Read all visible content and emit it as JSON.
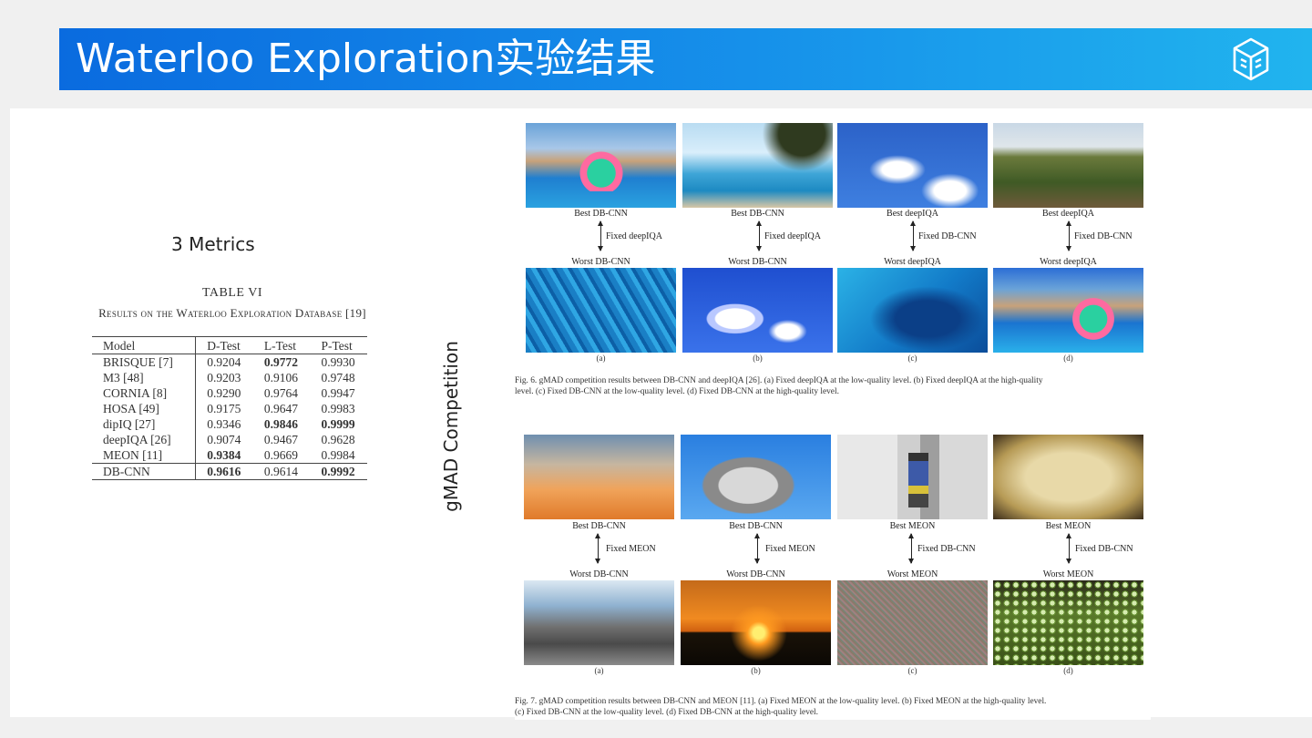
{
  "header": {
    "title": "Waterloo Exploration实验结果",
    "logo_icon": "cube-logo-icon",
    "gradient_colors": [
      "#0a6bdf",
      "#21b4ee"
    ]
  },
  "left": {
    "metrics_label": "3  Metrics",
    "table_number": "TABLE VI",
    "table_title": "Results on the Waterloo Exploration Database [19]",
    "columns": [
      "Model",
      "D-Test",
      "L-Test",
      "P-Test"
    ],
    "rows": [
      [
        "BRISQUE [7]",
        "0.9204",
        "0.9772",
        "0.9930"
      ],
      [
        "M3 [48]",
        "0.9203",
        "0.9106",
        "0.9748"
      ],
      [
        "CORNIA [8]",
        "0.9290",
        "0.9764",
        "0.9947"
      ],
      [
        "HOSA [49]",
        "0.9175",
        "0.9647",
        "0.9983"
      ],
      [
        "dipIQ [27]",
        "0.9346",
        "0.9846",
        "0.9999"
      ],
      [
        "deepIQA [26]",
        "0.9074",
        "0.9467",
        "0.9628"
      ],
      [
        "MEON [11]",
        "0.9384",
        "0.9669",
        "0.9984"
      ],
      [
        "DB-CNN",
        "0.9616",
        "0.9614",
        "0.9992"
      ]
    ]
  },
  "side_label": "gMAD Competition",
  "fig6": {
    "best": [
      "Best DB-CNN",
      "Best DB-CNN",
      "Best deepIQA",
      "Best deepIQA"
    ],
    "fixed": [
      "Fixed deepIQA",
      "Fixed deepIQA",
      "Fixed DB-CNN",
      "Fixed DB-CNN"
    ],
    "worst": [
      "Worst DB-CNN",
      "Worst DB-CNN",
      "Worst deepIQA",
      "Worst deepIQA"
    ],
    "subs": [
      "(a)",
      "(b)",
      "(c)",
      "(d)"
    ],
    "caption_1": "Fig. 6.   gMAD competition results between DB-CNN and deepIQA [26]. (a) Fixed deepIQA at the low-quality level. (b) Fixed deepIQA at the high-quality",
    "caption_2": "level. (c) Fixed DB-CNN at the low-quality level. (d) Fixed DB-CNN at the high-quality level."
  },
  "fig7": {
    "best": [
      "Best DB-CNN",
      "Best DB-CNN",
      "Best MEON",
      "Best MEON"
    ],
    "fixed": [
      "Fixed MEON",
      "Fixed MEON",
      "Fixed DB-CNN",
      "Fixed DB-CNN"
    ],
    "worst": [
      "Worst DB-CNN",
      "Worst DB-CNN",
      "Worst MEON",
      "Worst MEON"
    ],
    "subs": [
      "(a)",
      "(b)",
      "(c)",
      "(d)"
    ],
    "caption_1": "Fig. 7.   gMAD competition results between DB-CNN and MEON [11]. (a) Fixed MEON at the low-quality level. (b) Fixed MEON at the high-quality level.",
    "caption_2": "(c) Fixed DB-CNN at the low-quality level. (d) Fixed DB-CNN at the high-quality level."
  }
}
